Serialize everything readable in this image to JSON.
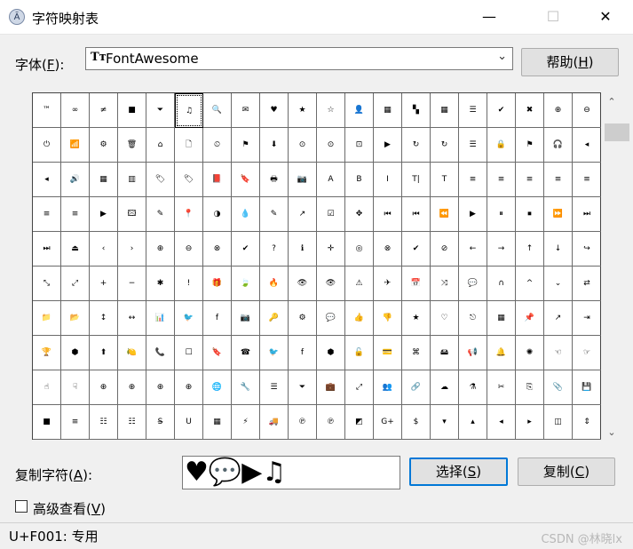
{
  "window": {
    "title": "字符映射表",
    "icon_name": "charmap-app-icon",
    "minimize_glyph": "—",
    "maximize_glyph": "☐",
    "close_glyph": "✕"
  },
  "font_row": {
    "label_prefix": "字体(",
    "label_key": "F",
    "label_suffix": "):",
    "font_type_glyph": "Tт",
    "selected_font": "FontAwesome",
    "dropdown_glyph": "⌄",
    "help_prefix": "帮助(",
    "help_key": "H",
    "help_suffix": ")"
  },
  "grid": {
    "columns": 20,
    "selected_index": 5,
    "rows": [
      [
        "™",
        "∞",
        "≠",
        "■",
        "⏷",
        "♫",
        "🔍",
        "✉",
        "♥",
        "★",
        "☆",
        "👤",
        "▦",
        "▚",
        "▦",
        "☰",
        "✔",
        "✖",
        "⊕",
        "⊖"
      ],
      [
        "⏻",
        "📶",
        "⚙",
        "🗑",
        "⌂",
        "🗋",
        "⏲",
        "⚑",
        "⬇",
        "⊙",
        "⊙",
        "⊡",
        "▶",
        "↻",
        "↻",
        "☰",
        "🔒",
        "⚑",
        "🎧",
        "◂"
      ],
      [
        "◂",
        "🔊",
        "▦",
        "▥",
        "🏷",
        "🏷",
        "📕",
        "🔖",
        "🖶",
        "📷",
        "A",
        "B",
        "I",
        "T|",
        "T",
        "≡",
        "≡",
        "≡",
        "≡",
        "≡"
      ],
      [
        "≡",
        "≡",
        "▶",
        "🖾",
        "✎",
        "📍",
        "◑",
        "💧",
        "✎",
        "↗",
        "☑",
        "✥",
        "⏮",
        "⏮",
        "⏪",
        "▶",
        "⏸",
        "⏹",
        "⏩",
        "⏭"
      ],
      [
        "⏭",
        "⏏",
        "‹",
        "›",
        "⊕",
        "⊖",
        "⊗",
        "✔",
        "?",
        "ℹ",
        "✛",
        "◎",
        "⊗",
        "✔",
        "⊘",
        "←",
        "→",
        "↑",
        "↓",
        "↪"
      ],
      [
        "⤡",
        "⤢",
        "+",
        "−",
        "✱",
        "!",
        "🎁",
        "🍃",
        "🔥",
        "👁",
        "👁",
        "⚠",
        "✈",
        "📅",
        "⤨",
        "💬",
        "∩",
        "^",
        "⌄",
        "⇄",
        "🛒"
      ],
      [
        "📁",
        "📂",
        "↕",
        "↔",
        "📊",
        "🐦",
        "f",
        "📷",
        "🔑",
        "⚙",
        "💬",
        "👍",
        "👎",
        "★",
        "♡",
        "⎋",
        "▦",
        "📌",
        "↗",
        "⇥"
      ],
      [
        "🏆",
        "⬢",
        "⬆",
        "🍋",
        "📞",
        "☐",
        "🔖",
        "☎",
        "🐦",
        "f",
        "⬢",
        "🔓",
        "💳",
        "⌘",
        "🖴",
        "📢",
        "🔔",
        "✺",
        "☜",
        "☞"
      ],
      [
        "☝",
        "☟",
        "⊕",
        "⊕",
        "⊕",
        "⊕",
        "🌐",
        "🔧",
        "☰",
        "⏷",
        "💼",
        "⤢",
        "👥",
        "🔗",
        "☁",
        "⚗",
        "✂",
        "⎘",
        "📎",
        "💾"
      ],
      [
        "■",
        "≡",
        "☷",
        "☷",
        "S̶",
        "U",
        "▦",
        "⚡",
        "🚚",
        "℗",
        "℗",
        "◩",
        "G+",
        "$",
        "▾",
        "▴",
        "◂",
        "▸",
        "◫",
        "⇕"
      ]
    ]
  },
  "copy_row": {
    "label_prefix": "复制字符(",
    "label_key": "A",
    "label_suffix": "):",
    "value": "♥💬▶♫",
    "select_prefix": "选择(",
    "select_key": "S",
    "select_suffix": ")",
    "copy_prefix": "复制(",
    "copy_key": "C",
    "copy_suffix": ")"
  },
  "advanced": {
    "label_prefix": "高级查看(",
    "label_key": "V",
    "label_suffix": ")",
    "checked": false
  },
  "status": {
    "text": "U+F001: 专用",
    "watermark": "CSDN @林晓lx"
  },
  "scrollbar": {
    "up_glyph": "⌃",
    "down_glyph": "⌄"
  }
}
